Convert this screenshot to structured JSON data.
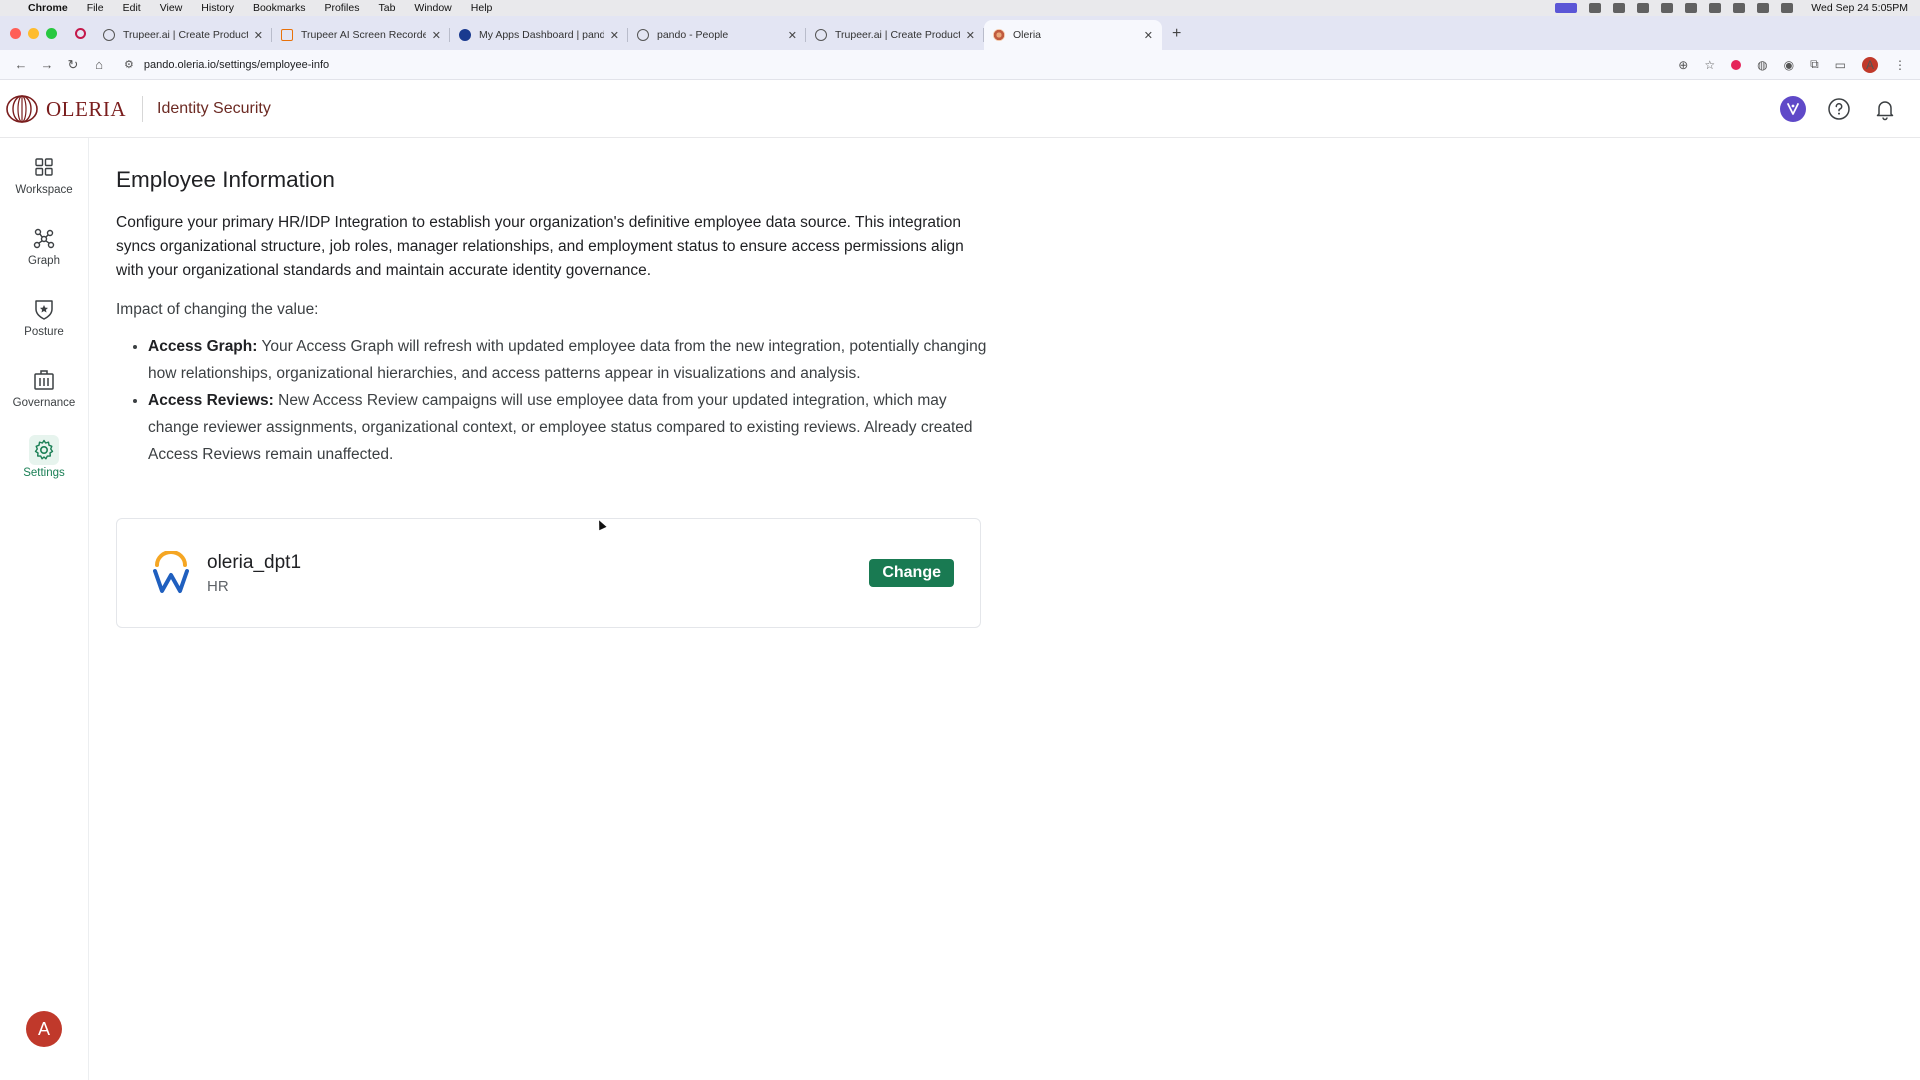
{
  "mac_menu": {
    "app_name": "Chrome",
    "items": [
      "File",
      "Edit",
      "View",
      "History",
      "Bookmarks",
      "Profiles",
      "Tab",
      "Window",
      "Help"
    ],
    "clock": "Wed Sep 24  5:05PM"
  },
  "browser": {
    "tabs": [
      {
        "title": "Trupeer.ai | Create Product V",
        "icon": "trupeer-icon"
      },
      {
        "title": "Trupeer AI Screen Recorder",
        "icon": "trupeer-recorder-icon"
      },
      {
        "title": "My Apps Dashboard | pando",
        "icon": "okta-icon"
      },
      {
        "title": "pando - People",
        "icon": "pando-icon"
      },
      {
        "title": "Trupeer.ai | Create Product V",
        "icon": "trupeer-icon"
      },
      {
        "title": "Oleria",
        "icon": "oleria-icon",
        "active": true
      }
    ],
    "url": "pando.oleria.io/settings/employee-info",
    "profile_initial": "A"
  },
  "header": {
    "logo_text": "OLERIA",
    "product_name": "Identity Security"
  },
  "sidebar": {
    "items": [
      {
        "label": "Workspace",
        "icon": "grid-icon"
      },
      {
        "label": "Graph",
        "icon": "graph-nodes-icon"
      },
      {
        "label": "Posture",
        "icon": "shield-star-icon"
      },
      {
        "label": "Governance",
        "icon": "building-icon"
      },
      {
        "label": "Settings",
        "icon": "gear-icon",
        "active": true
      }
    ],
    "avatar_initial": "A"
  },
  "main": {
    "title": "Employee Information",
    "description": "Configure your primary HR/IDP Integration to establish your organization's definitive employee data source. This integration syncs organizational structure, job roles, manager relationships, and employment status to ensure access permissions align with your organizational standards and maintain accurate identity governance.",
    "impact_label": "Impact of changing the value:",
    "impacts": [
      {
        "title": "Access Graph:",
        "text": "Your Access Graph will refresh with updated employee data from the new integration, potentially changing how relationships, organizational hierarchies, and access patterns appear in visualizations and analysis."
      },
      {
        "title": "Access Reviews:",
        "text": "New Access Review campaigns will use employee data from your updated integration, which may change reviewer assignments, organizational context, or employee status compared to existing reviews. Already created Access Reviews remain unaffected."
      }
    ],
    "integration": {
      "name": "oleria_dpt1",
      "type": "HR",
      "logo": "workday-icon",
      "change_label": "Change"
    }
  },
  "colors": {
    "accent_green": "#197a52",
    "brand_maroon": "#7a1d1d",
    "ai_purple": "#5f49c8"
  }
}
